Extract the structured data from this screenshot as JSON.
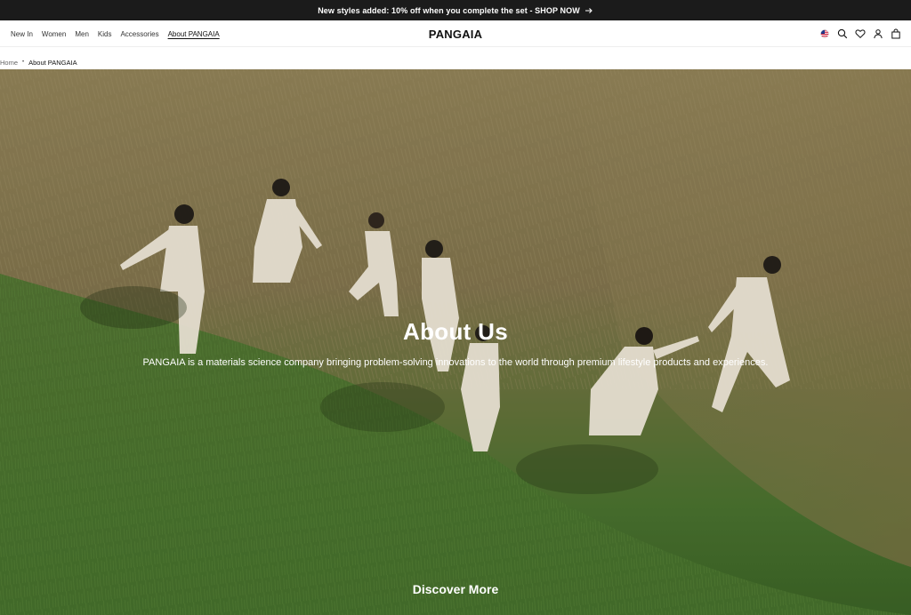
{
  "announcement": {
    "text": "New styles added: 10% off when you complete the set - SHOP NOW",
    "arrow_icon": "arrow-right-icon"
  },
  "header": {
    "nav": [
      {
        "label": "New In"
      },
      {
        "label": "Women"
      },
      {
        "label": "Men"
      },
      {
        "label": "Kids"
      },
      {
        "label": "Accessories"
      },
      {
        "label": "About PANGAIA",
        "active": true
      }
    ],
    "logo": "PANGAIA",
    "icons": [
      "us-flag-icon",
      "search-icon",
      "heart-icon",
      "account-icon",
      "bag-icon"
    ]
  },
  "breadcrumb": {
    "home": "Home",
    "separator": "•",
    "current": "About PANGAIA"
  },
  "hero": {
    "title": "About Us",
    "subtitle": "PANGAIA is a materials science company bringing problem-solving innovations to the world through premium lifestyle products and experiences.",
    "cta": "Discover More"
  },
  "colors": {
    "announcement_bg": "#1b1b1b",
    "text_dark": "#111111",
    "grass_dry": "#9a8a5c",
    "grass_green": "#4f7a32"
  }
}
